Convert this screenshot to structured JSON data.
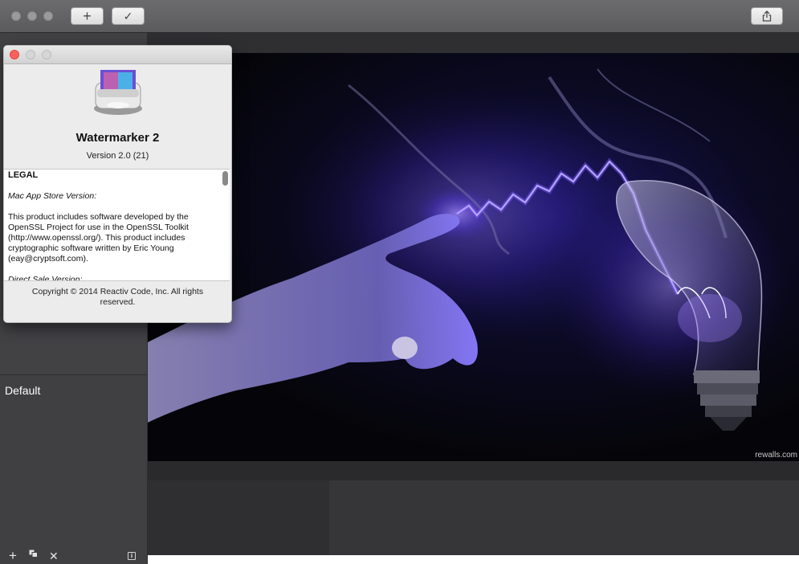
{
  "toolbar": {
    "add_label": "+",
    "confirm_label": "✓",
    "share_icon": "share-icon"
  },
  "sidebar": {
    "preset_name": "Default",
    "tools": {
      "add": "+",
      "duplicate_icon": "duplicate-icon",
      "delete": "✕",
      "info": "i"
    }
  },
  "about": {
    "app_name": "Watermarker 2",
    "version": "Version 2.0 (21)",
    "legal": {
      "heading": "LEGAL",
      "mas_heading": "Mac App Store Version:",
      "mas_text": "This product includes software developed by the OpenSSL Project for use in the OpenSSL Toolkit (http://www.openssl.org/). This product includes cryptographic software written by Eric Young (eay@cryptsoft.com).",
      "direct_heading": "Direct Sale Version:"
    },
    "copyright": "Copyright © 2014 Reactiv Code, Inc. All rights reserved."
  },
  "image": {
    "watermark": "rewalls.com"
  },
  "colors": {
    "close_red": "#fc605c",
    "glow_purple": "#7a5cff"
  }
}
